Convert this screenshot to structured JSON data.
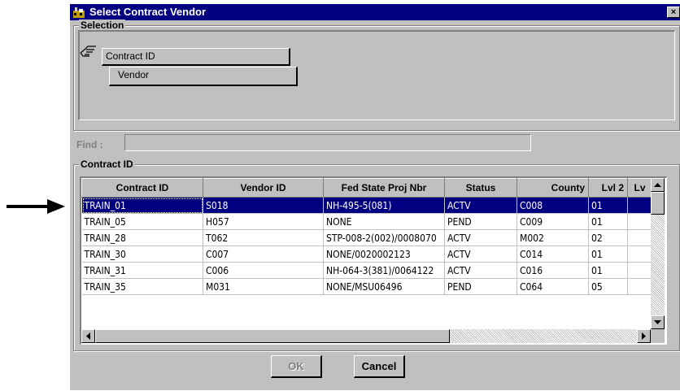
{
  "window": {
    "title": "Select Contract Vendor",
    "close_glyph": "×"
  },
  "selection": {
    "label": "Selection",
    "items": [
      {
        "label": "Contract ID"
      },
      {
        "label": "Vendor"
      }
    ]
  },
  "find": {
    "label": "Find :",
    "value": ""
  },
  "grid": {
    "label": "Contract ID",
    "columns": [
      "Contract ID",
      "Vendor ID",
      "Fed State Proj Nbr",
      "Status",
      "County",
      "Lvl 2",
      "Lv"
    ],
    "rows": [
      [
        "TRAIN_01",
        "S018",
        "NH-495-5(081)",
        "ACTV",
        "C008",
        "01",
        ""
      ],
      [
        "TRAIN_05",
        "H057",
        "NONE",
        "PEND",
        "C009",
        "01",
        ""
      ],
      [
        "TRAIN_28",
        "T062",
        "STP-008-2(002)/0008070",
        "ACTV",
        "M002",
        "02",
        ""
      ],
      [
        "TRAIN_30",
        "C007",
        "NONE/0020002123",
        "ACTV",
        "C014",
        "01",
        ""
      ],
      [
        "TRAIN_31",
        "C006",
        "NH-064-3(381)/0064122",
        "ACTV",
        "C016",
        "01",
        ""
      ],
      [
        "TRAIN_35",
        "M031",
        "NONE/MSU06496",
        "PEND",
        "C064",
        "05",
        ""
      ]
    ],
    "selected_row": 0
  },
  "buttons": {
    "ok": "OK",
    "cancel": "Cancel"
  },
  "icons": {
    "app": "app-icon",
    "hand": "pointing-hand-icon",
    "arrow": "pointer-arrow-icon"
  },
  "colors": {
    "titlebar": "#000080",
    "face": "#c0c0c0",
    "selection": "#000080"
  }
}
